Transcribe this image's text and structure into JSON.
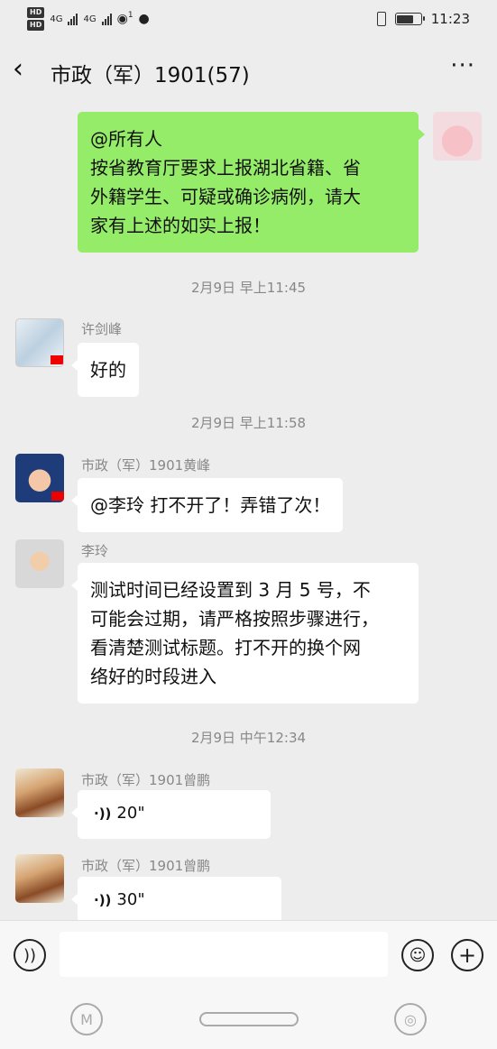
{
  "status_bar": {
    "hd1": "HD",
    "hd2": "HD",
    "net1": "4G",
    "net2": "4G",
    "wifi_label": "1",
    "time": "11:23"
  },
  "header": {
    "back_icon": "chevron-left-icon",
    "title": "市政（军）1901(57)",
    "more": "···"
  },
  "messages": [
    {
      "side": "right",
      "lines": [
        "@所有人",
        "按省教育厅要求上报湖北省籍、省",
        "外籍学生、可疑或确诊病例，请大",
        "家有上述的如实上报！"
      ]
    },
    {
      "time": "2月9日 早上11:45"
    },
    {
      "side": "left",
      "sender": "许剑峰",
      "text": "好的"
    },
    {
      "time": "2月9日 早上11:58"
    },
    {
      "side": "left",
      "sender": "市政（军）1901黄峰",
      "text": "@李玲  打不开了！弄错了次！"
    },
    {
      "side": "left",
      "sender": "李玲",
      "lines": [
        "测试时间已经设置到 3 月 5 号，不",
        "可能会过期，请严格按照步骤进行，",
        "看清楚测试标题。打不开的换个网",
        "络好的时段进入"
      ]
    },
    {
      "time": "2月9日 中午12:34"
    },
    {
      "side": "left",
      "sender": "市政（军）1901曾鹏",
      "voice": "20\""
    },
    {
      "side": "left",
      "sender": "市政（军）1901曾鹏",
      "voice": "30\""
    }
  ],
  "input_bar": {
    "voice_icon": "voice-mode-icon",
    "emoji_icon": "emoji-icon",
    "plus_icon": "plus-icon",
    "plus": "+",
    "placeholder": ""
  },
  "colors": {
    "background": "#ededed",
    "self_bubble": "#95ec69",
    "other_bubble": "#ffffff",
    "meta_text": "#888888"
  }
}
